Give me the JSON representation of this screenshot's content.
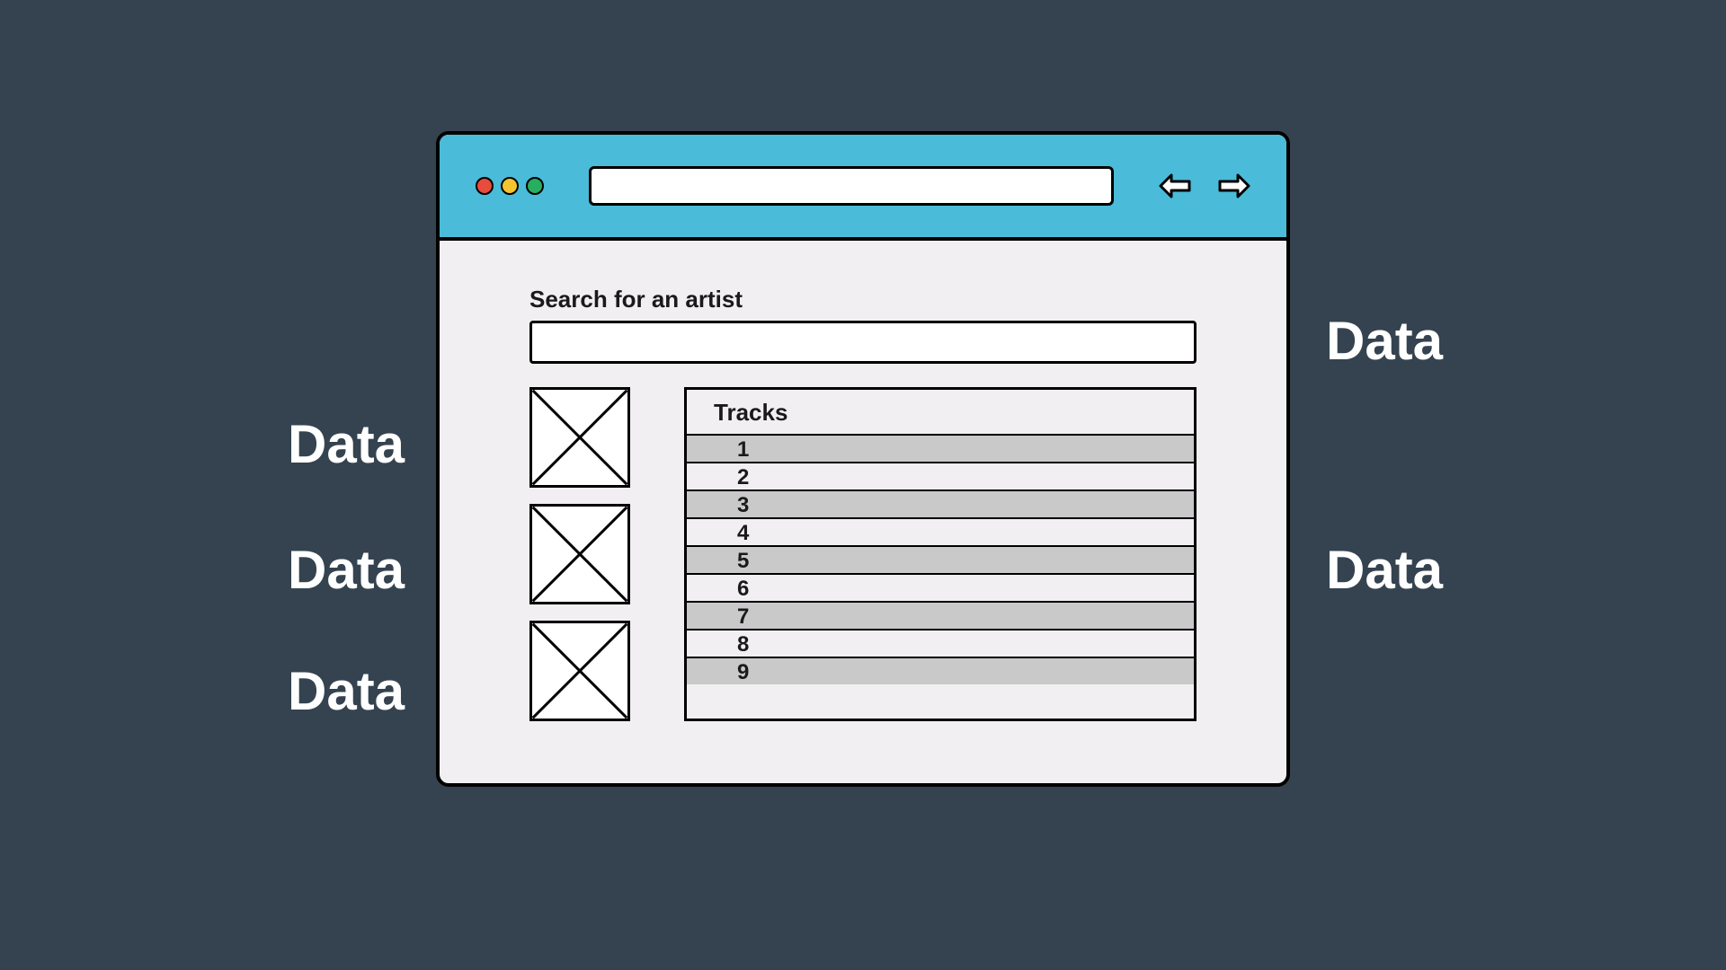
{
  "side_labels": {
    "left": [
      "Data",
      "Data",
      "Data"
    ],
    "right": [
      "Data",
      "Data"
    ]
  },
  "browser": {
    "url": ""
  },
  "search": {
    "label": "Search for an artist",
    "value": ""
  },
  "tracks": {
    "header": "Tracks",
    "rows": [
      "1",
      "2",
      "3",
      "4",
      "5",
      "6",
      "7",
      "8",
      "9"
    ]
  },
  "thumbnail_count": 3
}
